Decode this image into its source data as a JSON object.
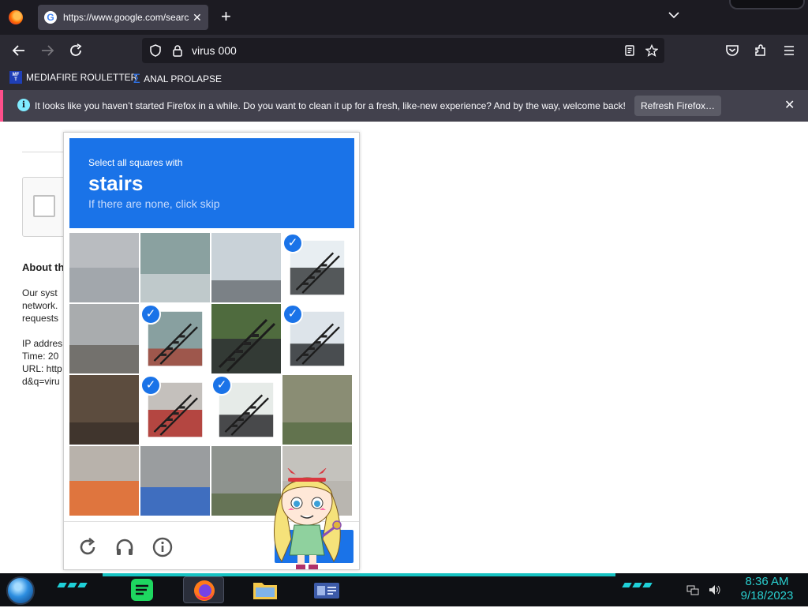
{
  "browser": {
    "tab": {
      "title": "https://www.google.com/search?",
      "favicon": "google-g-icon"
    },
    "url": "virus 000",
    "bookmarks": [
      {
        "label": "MEDIAFIRE ROULETTER",
        "icon": "mediafire-icon"
      },
      {
        "label": "ANAL PROLAPSE",
        "icon": "sigma-icon"
      }
    ],
    "notification": {
      "text": "It looks like you haven’t started Firefox in a while. Do you want to clean it up for a fresh, like-new experience? And by the way, welcome back!",
      "button": "Refresh Firefox…"
    }
  },
  "page": {
    "about": "About th",
    "lines": [
      "Our syst",
      "network.",
      "requests",
      "",
      "IP addres",
      "Time: 20",
      "URL: http",
      "d&q=viru"
    ]
  },
  "captcha": {
    "instruction_small": "Select all squares with",
    "target": "stairs",
    "hint": "If there are none, click skip",
    "selected_tiles": [
      3,
      5,
      7,
      9,
      10
    ],
    "footer_icons": [
      "reload-icon",
      "headphones-icon",
      "info-icon"
    ]
  },
  "taskbar": {
    "apps": [
      "spotify-icon",
      "firefox-icon",
      "file-explorer-icon",
      "id-card-icon"
    ],
    "time": "8:36 AM",
    "date": "9/18/2023"
  },
  "colors": {
    "captcha_blue": "#1a73e8",
    "firefox_dark": "#1c1b22",
    "notification_accent": "#ff4f8b",
    "clock": "#2ad0d0"
  }
}
